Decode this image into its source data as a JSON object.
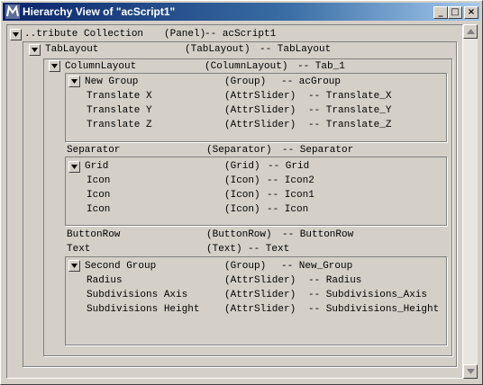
{
  "window": {
    "title": "Hierarchy View of \"acScript1\"",
    "buttons": {
      "minimize": "_",
      "maximize": "□",
      "close": "×"
    }
  },
  "tree": {
    "root": {
      "name": "..tribute Collection",
      "type": "(Panel)",
      "ref": "-- acScript1"
    },
    "tab_layout": {
      "name": "TabLayout",
      "type": "(TabLayout)",
      "ref": "-- TabLayout"
    },
    "column_layout": {
      "name": "ColumnLayout",
      "type": "(ColumnLayout)",
      "ref": "-- Tab_1"
    },
    "new_group": {
      "header": {
        "name": "New Group",
        "type": "(Group)",
        "ref": "-- acGroup"
      },
      "items": [
        {
          "name": "Translate X",
          "type": "(AttrSlider)",
          "ref": "-- Translate_X"
        },
        {
          "name": "Translate Y",
          "type": "(AttrSlider)",
          "ref": "-- Translate_Y"
        },
        {
          "name": "Translate Z",
          "type": "(AttrSlider)",
          "ref": "-- Translate_Z"
        }
      ]
    },
    "separator": {
      "name": "Separator",
      "type": "(Separator)",
      "ref": "-- Separator"
    },
    "grid": {
      "header": {
        "name": "Grid",
        "type": "(Grid)",
        "ref": "-- Grid"
      },
      "items": [
        {
          "name": "Icon",
          "type": "(Icon)",
          "ref": "-- Icon2"
        },
        {
          "name": "Icon",
          "type": "(Icon)",
          "ref": "-- Icon1"
        },
        {
          "name": "Icon",
          "type": "(Icon)",
          "ref": "-- Icon"
        }
      ]
    },
    "button_row": {
      "name": "ButtonRow",
      "type": "(ButtonRow)",
      "ref": "-- ButtonRow"
    },
    "text": {
      "name": "Text",
      "type": "(Text)",
      "ref": "-- Text"
    },
    "second_group": {
      "header": {
        "name": "Second Group",
        "type": "(Group)",
        "ref": "-- New_Group"
      },
      "items": [
        {
          "name": "Radius",
          "type": "(AttrSlider)",
          "ref": "-- Radius"
        },
        {
          "name": "Subdivisions Axis",
          "type": "(AttrSlider)",
          "ref": "-- Subdivisions_Axis"
        },
        {
          "name": "Subdivisions Height",
          "type": "(AttrSlider)",
          "ref": "-- Subdivisions_Height"
        }
      ]
    }
  }
}
